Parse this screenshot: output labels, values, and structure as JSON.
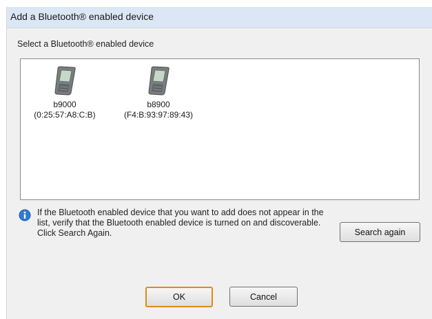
{
  "window": {
    "title": "Add a Bluetooth® enabled device"
  },
  "prompt": "Select a Bluetooth® enabled device",
  "devices": [
    {
      "name": "b9000",
      "address": "(0:25:57:A8:C:B)",
      "icon": "mobile-phone-icon"
    },
    {
      "name": "b8900",
      "address": "(F4:B:93:97:89:43)",
      "icon": "mobile-phone-icon"
    }
  ],
  "info": {
    "icon": "info-icon",
    "text": "If the Bluetooth enabled device that you want to add does not appear in the list, verify that the Bluetooth enabled device is turned on and discoverable. Click Search Again."
  },
  "buttons": {
    "search_again": "Search again",
    "ok": "OK",
    "cancel": "Cancel"
  },
  "colors": {
    "titlebar": "#dbe7f5",
    "dialog_background": "#f0f0f0",
    "default_button_border": "#e08a1a",
    "info_icon": "#2f7ad8"
  }
}
